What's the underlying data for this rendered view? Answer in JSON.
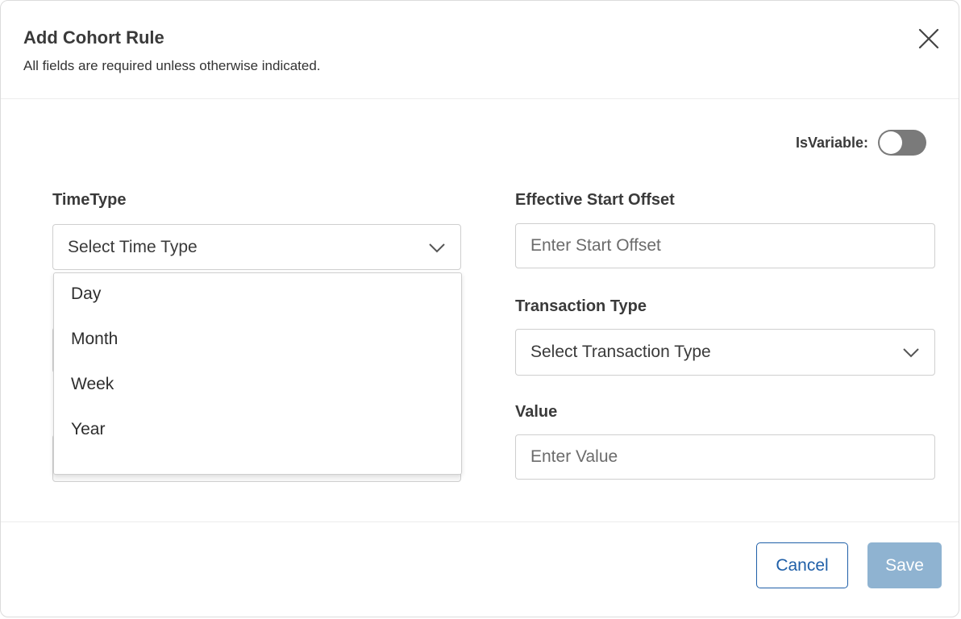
{
  "modal": {
    "title": "Add Cohort Rule",
    "subtitle": "All fields are required unless otherwise indicated."
  },
  "toggle": {
    "label": "IsVariable:",
    "on": false
  },
  "fields": {
    "time_type": {
      "label": "TimeType",
      "value": "Select Time Type"
    },
    "start_offset": {
      "label": "Effective Start Offset",
      "placeholder": "Enter Start Offset"
    },
    "transaction_type": {
      "label": "Transaction Type",
      "value": "Select Transaction Type"
    },
    "value": {
      "label": "Value",
      "placeholder": "Enter Value"
    }
  },
  "dropdown": {
    "options": [
      "Day",
      "Month",
      "Week",
      "Year"
    ]
  },
  "buttons": {
    "cancel": "Cancel",
    "save": "Save"
  },
  "colors": {
    "primary": "#1f5fa8",
    "save_disabled": "#8fb3d1",
    "toggle_off": "#7a7a7a"
  },
  "icons": {
    "close": "close-icon",
    "chevron": "chevron-down-icon"
  }
}
